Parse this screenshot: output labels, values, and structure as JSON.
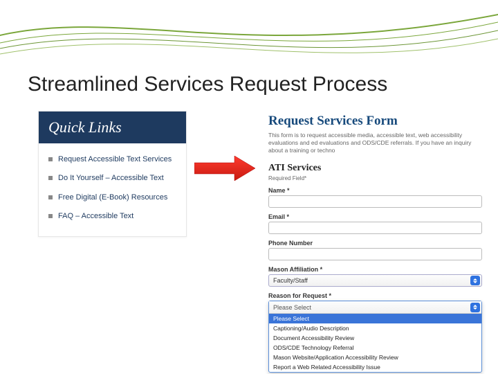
{
  "slide": {
    "title": "Streamlined Services Request Process"
  },
  "quicklinks": {
    "header": "Quick Links",
    "items": [
      {
        "label": "Request Accessible Text Services"
      },
      {
        "label": "Do It Yourself – Accessible Text"
      },
      {
        "label": "Free Digital (E-Book) Resources"
      },
      {
        "label": "FAQ – Accessible Text"
      }
    ]
  },
  "form": {
    "title": "Request Services Form",
    "intro": "This form is to request accessible media, accessible text, web accessibility evaluations and ed evaluations and ODS/CDE referrals. If you have an inquiry about a training or techno",
    "section_title": "ATI Services",
    "required_note": "Required Field*",
    "fields": {
      "name": {
        "label": "Name *"
      },
      "email": {
        "label": "Email *"
      },
      "phone": {
        "label": "Phone Number"
      },
      "affiliation": {
        "label": "Mason Affiliation *",
        "value": "Faculty/Staff"
      },
      "reason": {
        "label": "Reason for Request *",
        "value": "Please Select",
        "options": [
          "Please Select",
          "Captioning/Audio Description",
          "Document Accessibility Review",
          "ODS/CDE Technology Referral",
          "Mason Website/Application Accessibility Review",
          "Report a Web Related Accessibility Issue"
        ]
      }
    }
  }
}
